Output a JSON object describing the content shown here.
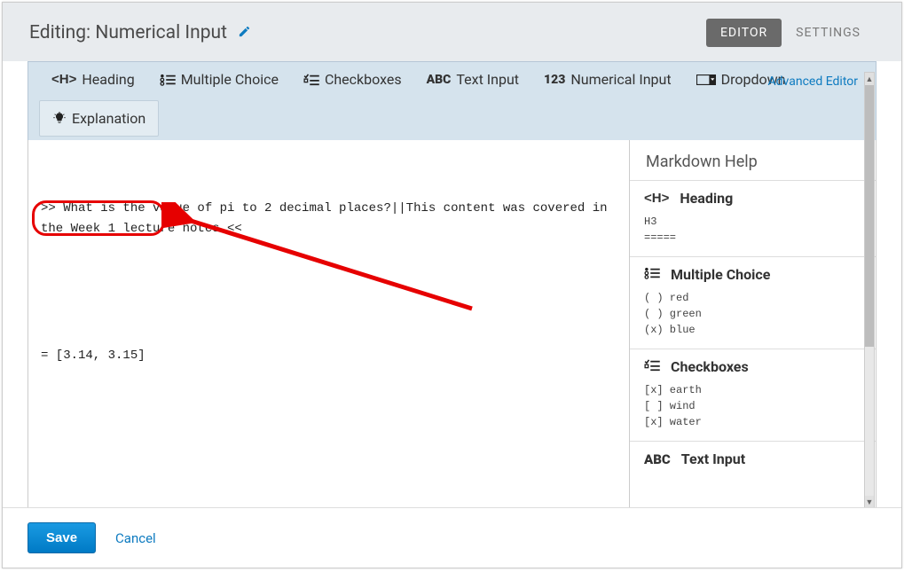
{
  "header": {
    "title": "Editing: Numerical Input",
    "tabs": {
      "editor": "EDITOR",
      "settings": "SETTINGS"
    }
  },
  "toolbar": {
    "heading": "Heading",
    "multiple_choice": "Multiple Choice",
    "checkboxes": "Checkboxes",
    "text_input": "Text Input",
    "numerical_input": "Numerical Input",
    "dropdown": "Dropdown",
    "explanation": "Explanation",
    "advanced": "Advanced Editor"
  },
  "editor": {
    "line1": ">> What is the value of pi to 2 decimal places?||This content was covered in the Week 1 lecture notes.<<",
    "line2": "= [3.14, 3.15]"
  },
  "help": {
    "title": "Markdown Help",
    "heading": {
      "label": "Heading",
      "example": "H3\n====="
    },
    "multiple_choice": {
      "label": "Multiple Choice",
      "example": "( ) red\n( ) green\n(x) blue"
    },
    "checkboxes": {
      "label": "Checkboxes",
      "example": "[x] earth\n[ ] wind\n[x] water"
    },
    "text_input": {
      "label": "Text Input"
    }
  },
  "footer": {
    "save": "Save",
    "cancel": "Cancel"
  }
}
